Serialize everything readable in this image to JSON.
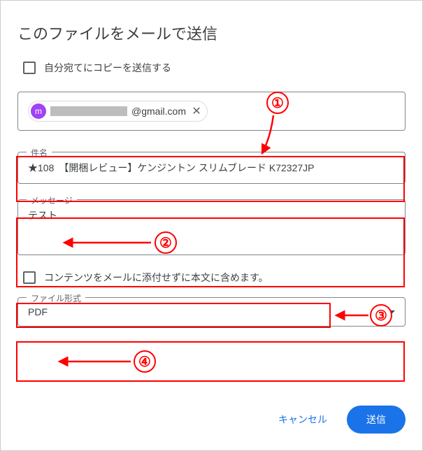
{
  "dialog": {
    "title": "このファイルをメールで送信",
    "copy_checkbox_label": "自分宛てにコピーを送信する"
  },
  "recipient": {
    "avatar_letter": "m",
    "email_suffix": "@gmail.com"
  },
  "subject": {
    "label": "件名",
    "value": "★108　【開梱レビュー】ケンジントン スリムブレード K72327JP"
  },
  "message": {
    "label": "メッセージ",
    "value": "テスト"
  },
  "inline_checkbox_label": "コンテンツをメールに添付せずに本文に含めます。",
  "file_format": {
    "label": "ファイル形式",
    "value": "PDF"
  },
  "buttons": {
    "cancel": "キャンセル",
    "send": "送信"
  },
  "annotations": {
    "n1": "①",
    "n2": "②",
    "n3": "③",
    "n4": "④"
  }
}
